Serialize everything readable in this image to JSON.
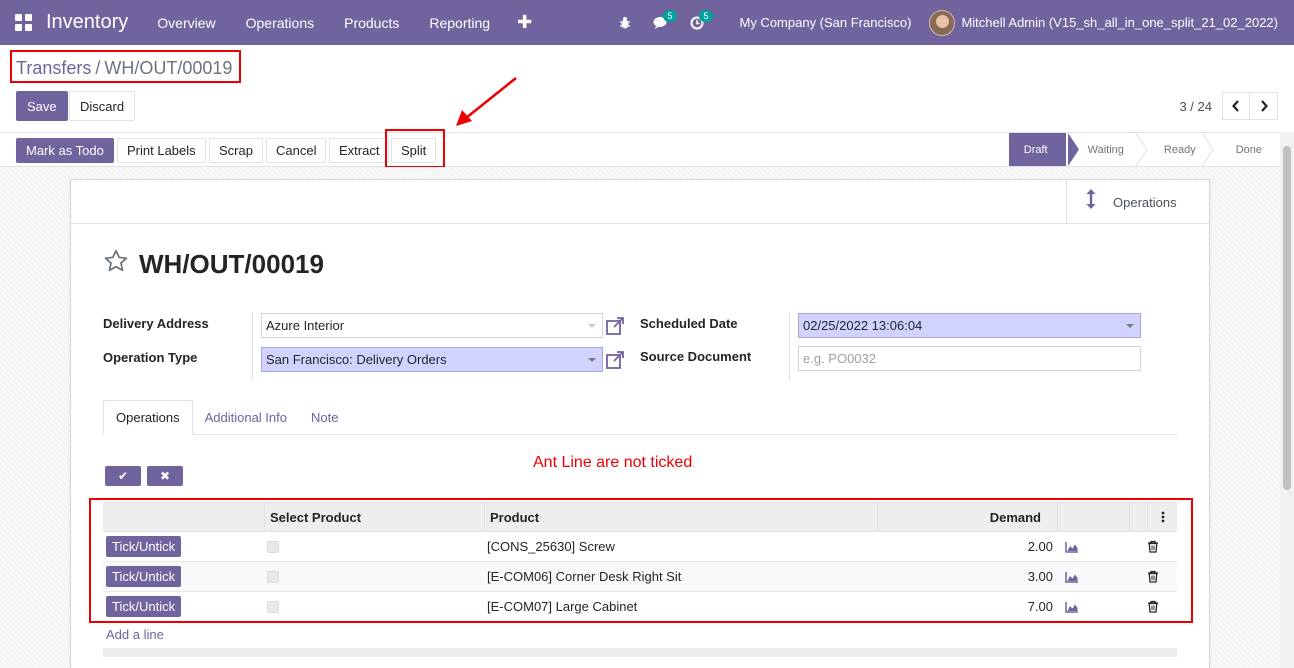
{
  "navbar": {
    "app_name": "Inventory",
    "menu": [
      "Overview",
      "Operations",
      "Products",
      "Reporting"
    ],
    "plus": "✚",
    "messages_badge": "5",
    "activity_badge": "5",
    "company": "My Company (San Francisco)",
    "user": "Mitchell Admin (V15_sh_all_in_one_split_21_02_2022)"
  },
  "breadcrumb": {
    "parent": "Transfers",
    "separator": "/",
    "current": "WH/OUT/00019"
  },
  "control": {
    "save_label": "Save",
    "discard_label": "Discard",
    "pager_value": "3 / 24",
    "prev_icon": "chevron-left-icon",
    "next_icon": "chevron-right-icon"
  },
  "statusbar": {
    "buttons": [
      "Mark as Todo",
      "Print Labels",
      "Scrap",
      "Cancel",
      "Extract",
      "Split"
    ],
    "stages": [
      "Draft",
      "Waiting",
      "Ready",
      "Done"
    ],
    "active_stage": "Draft"
  },
  "sheet": {
    "stat_button_label": "Operations",
    "title": "WH/OUT/00019",
    "delivery_address_label": "Delivery Address",
    "delivery_address_value": "Azure Interior",
    "operation_type_label": "Operation Type",
    "operation_type_value": "San Francisco: Delivery Orders",
    "scheduled_date_label": "Scheduled Date",
    "scheduled_date_value": "02/25/2022 13:06:04",
    "source_document_label": "Source Document",
    "source_document_placeholder": "e.g. PO0032",
    "tabs": [
      "Operations",
      "Additional Info",
      "Note"
    ],
    "active_tab": "Operations",
    "tick_all_icon": "✔",
    "untick_all_icon": "✖",
    "annotation": "Ant Line are not ticked",
    "table": {
      "headers": [
        "Select Product",
        "Product",
        "Demand"
      ],
      "rows": [
        {
          "button": "Tick/Untick",
          "selected": false,
          "product": "[CONS_25630] Screw",
          "demand": "2.00"
        },
        {
          "button": "Tick/Untick",
          "selected": false,
          "product": "[E-COM06] Corner Desk Right Sit",
          "demand": "3.00"
        },
        {
          "button": "Tick/Untick",
          "selected": false,
          "product": "[E-COM07] Large Cabinet",
          "demand": "7.00"
        }
      ]
    },
    "add_line_label": "Add a line"
  },
  "colors": {
    "brand": "#71639e",
    "annotation_red": "#ee0000",
    "required_field": "#d2d2ff"
  }
}
